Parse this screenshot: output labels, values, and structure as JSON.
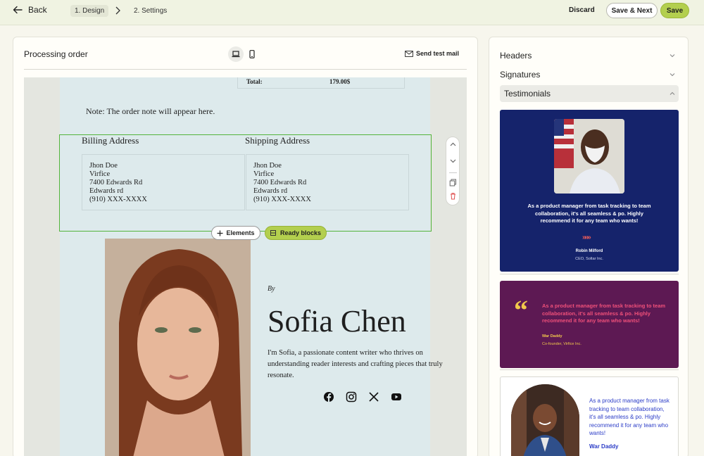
{
  "topbar": {
    "back_label": "Back",
    "steps": [
      "1. Design",
      "2. Settings"
    ],
    "discard_label": "Discard",
    "save_next_label": "Save & Next",
    "save_label": "Save"
  },
  "editor": {
    "title": "Processing order",
    "send_test_label": "Send test mail",
    "total_label": "Total:",
    "total_value": "179.00$",
    "note": "Note: The order note will appear here.",
    "billing": {
      "title": "Billing Address",
      "lines": [
        "Jhon Doe",
        "Virfice",
        "7400 Edwards Rd",
        "Edwards rd",
        "(910) XXX-XXXX"
      ]
    },
    "shipping": {
      "title": "Shipping Address",
      "lines": [
        "Jhon Doe",
        "Virfice",
        "7400 Edwards Rd",
        "Edwards rd",
        "(910) XXX-XXXX"
      ]
    },
    "elements_label": "Elements",
    "ready_blocks_label": "Ready blocks",
    "author": {
      "by": "By",
      "name": "Sofia Chen",
      "bio": "I'm Sofia, a passionate content writer who thrives on understanding reader interests and crafting pieces that truly resonate."
    },
    "social_icons": [
      "facebook-icon",
      "instagram-icon",
      "x-icon",
      "youtube-icon"
    ]
  },
  "panel": {
    "sections": [
      "Headers",
      "Signatures",
      "Testimonials"
    ],
    "open_section": "Testimonials",
    "testimonials": [
      {
        "quote": "As a product manager from task tracking to team collaboration, it's all seamless & po. Highly recommend it for any team who wants!",
        "arrows": "»»»",
        "name": "Robin Milford",
        "role": "CEO, Soltar Inc."
      },
      {
        "quote_mark": "“",
        "quote": "As a product manager from task tracking to team collaboration, it's all seamless & po. Highly recommend it for any team who wants!",
        "name": "War Daddy",
        "role": "Co-founder, Virfice Inc."
      },
      {
        "quote": "As a product manager from task tracking to team collaboration, it's all seamless & po. Highly recommend it for any team who wants!",
        "name": "War Daddy"
      }
    ]
  },
  "colors": {
    "accent": "#b3cf4e",
    "selection": "#52b43c",
    "card1_bg": "#15236b",
    "card2_bg": "#5d1953",
    "card3_text": "#2b3cc7"
  }
}
